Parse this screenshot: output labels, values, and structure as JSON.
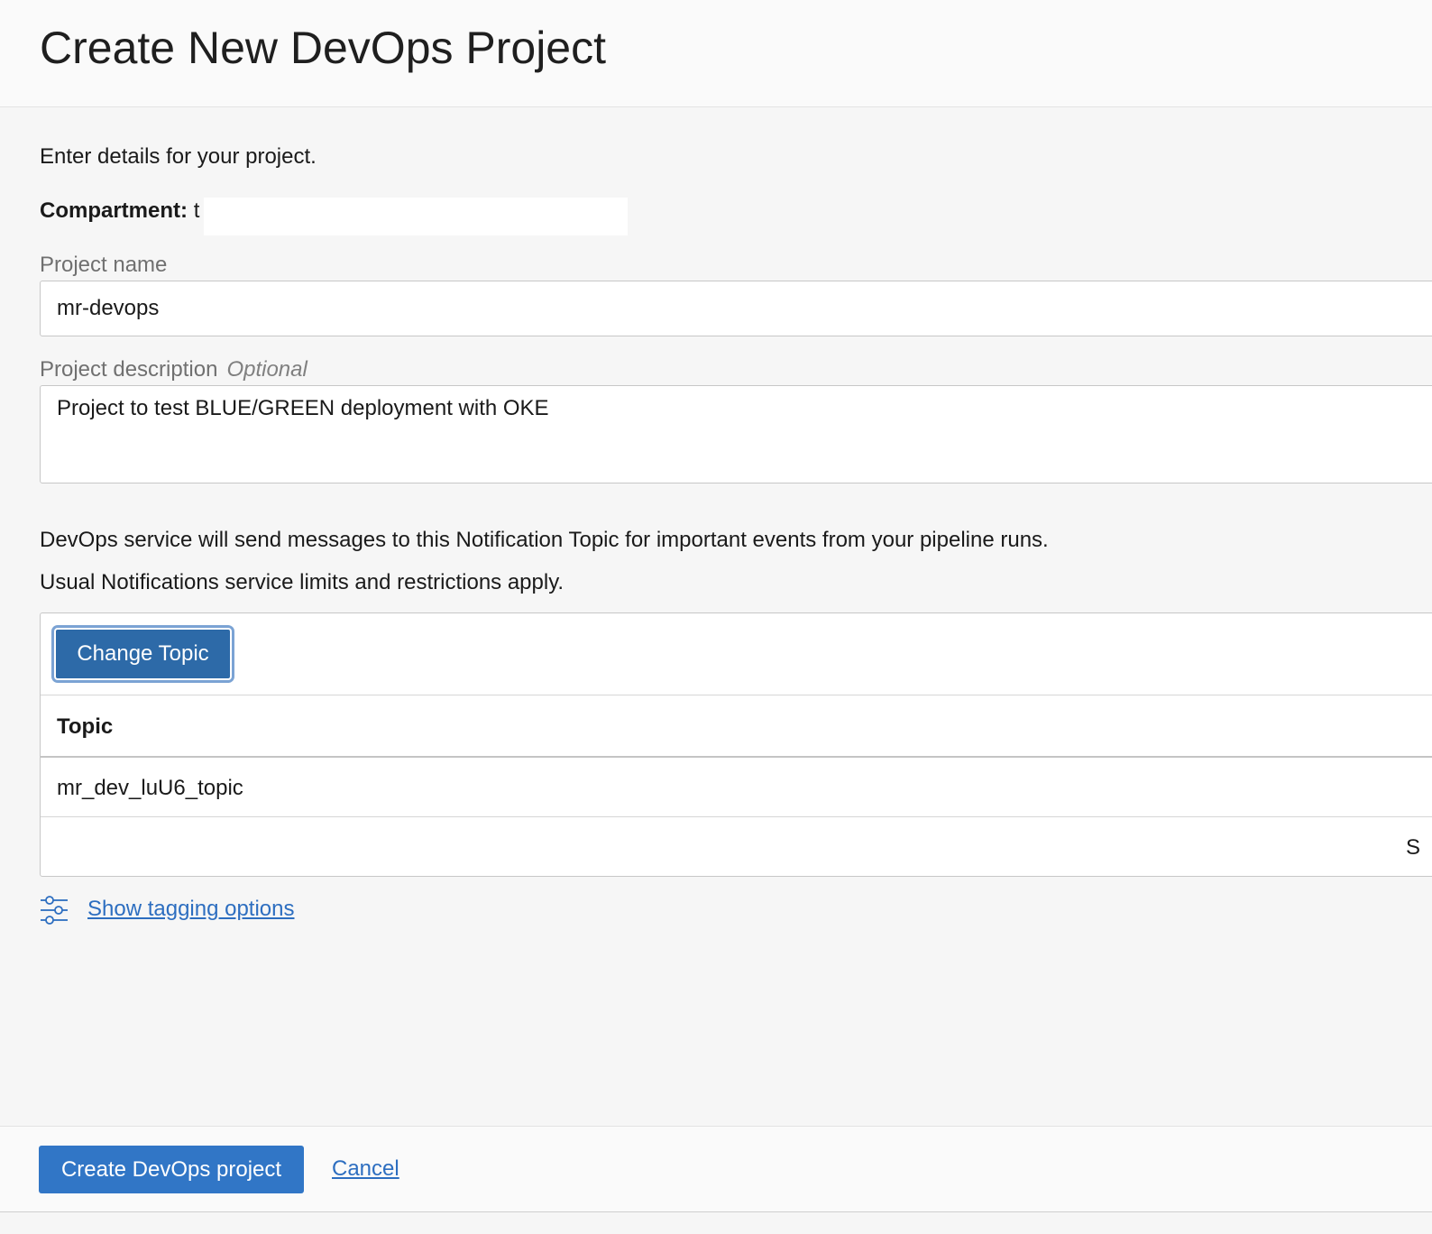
{
  "header": {
    "title": "Create New DevOps Project"
  },
  "form": {
    "intro": "Enter details for your project.",
    "compartment_label": "Compartment:",
    "compartment_value": "t",
    "project_name_label": "Project name",
    "project_name_value": "mr-devops",
    "project_description_label": "Project description",
    "project_description_optional": "Optional",
    "project_description_value": "Project to test BLUE/GREEN deployment with OKE",
    "notification_note": "DevOps service will send messages to this Notification Topic for important events from your pipeline runs.",
    "limits_note": "Usual Notifications service limits and restrictions apply."
  },
  "topic_panel": {
    "change_button_label": "Change Topic",
    "column_header": "Topic",
    "rows": [
      "mr_dev_luU6_topic"
    ],
    "footer_fragment": "S"
  },
  "tagging": {
    "link_label": "Show tagging options",
    "icon": "sliders-icon"
  },
  "footer": {
    "primary_label": "Create DevOps project",
    "cancel_label": "Cancel"
  },
  "colors": {
    "primary": "#3176c6",
    "change_button": "#2d6aa8",
    "link": "#2d6ec0",
    "background": "#f6f6f6"
  }
}
